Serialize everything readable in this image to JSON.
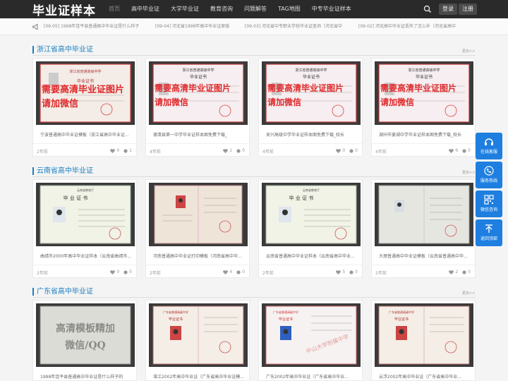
{
  "header": {
    "logo": "毕业证样本",
    "nav": [
      "首页",
      "高中毕业证",
      "大学毕业证",
      "教育咨询",
      "问题解答",
      "TAG地图",
      "中专毕业证样本"
    ],
    "login": "登录",
    "register": "注册"
  },
  "ticker": [
    "[09-05] 1998年连平县普通高中毕业证是什么样子",
    "[09-04] 河北省1998年高中毕业证原版",
    "[09-03] 河北省中专职业学校毕业证查询（河北省中",
    "[09-02] 河北高中毕业证丢失了怎么补（河北省高中"
  ],
  "more_label": "更多>>",
  "sections": [
    {
      "title": "浙江省高中毕业证",
      "cards": [
        {
          "caption": "宁波普通高中毕业证模板（浙江省高中毕业证...",
          "age": "2年前",
          "likes": "0",
          "comments": "1"
        },
        {
          "caption": "德清县第一中学毕业证样本图免费下载_",
          "age": "4年前",
          "likes": "1",
          "comments": "0"
        },
        {
          "caption": "吴兴高级中学毕业证样本图免费下载_校长",
          "age": "4年前",
          "likes": "0",
          "comments": "0"
        },
        {
          "caption": "湖州市菱湖中学毕业证样本图免费下载_校长",
          "age": "4年前",
          "likes": "6",
          "comments": "0"
        }
      ]
    },
    {
      "title": "云南省高中毕业证",
      "cards": [
        {
          "caption": "曲靖市2000年高中毕业证样本（云南省曲靖市...",
          "age": "2年前",
          "likes": "0",
          "comments": "0"
        },
        {
          "caption": "河南普通高中毕业证打印模板（河南省高中毕...",
          "age": "2年前",
          "likes": "4",
          "comments": "0"
        },
        {
          "caption": "云南省普通高中毕业证样本（云南省高中毕业...",
          "age": "2年前",
          "likes": "5",
          "comments": "0"
        },
        {
          "caption": "大理普通高中毕业证模板（云南省普通高中毕...",
          "age": "2年前",
          "likes": "2",
          "comments": "0"
        }
      ]
    },
    {
      "title": "广东省高中毕业证",
      "cards": [
        {
          "caption": "1998年连平县普通高中毕业证是什么样子的",
          "age": "",
          "likes": "",
          "comments": ""
        },
        {
          "caption": "湛江2002年高中毕业证（广东省高中毕业证模...",
          "age": "",
          "likes": "",
          "comments": ""
        },
        {
          "caption": "广东2002年高中毕业证（广东省高中毕业...",
          "age": "",
          "likes": "",
          "comments": ""
        },
        {
          "caption": "云浮2002年高中毕业证（广东省高中毕业...",
          "age": "",
          "likes": "",
          "comments": ""
        }
      ]
    }
  ],
  "watermarks": {
    "line1": "需要高清毕业证图片",
    "line2": "请加微信",
    "gd1": "高清模板精加",
    "gd2": "微信/QQ"
  },
  "cert_text": {
    "zj_school": "浙江省普通高级中学",
    "zj_school_alt": "浙江省普通高级中学",
    "cert": "毕业证书",
    "yn_title": "毕 业 证 书",
    "yn_dept": "云南省教育厅",
    "gd_school": "广东省普通高级中学",
    "gd_cert": "毕业证书",
    "gd_stamp": "中山大学附属中学"
  },
  "float_panel": [
    "在线客服",
    "服务热线",
    "微信咨询",
    "返回顶部"
  ],
  "colors": {
    "accent": "#1a7fc1",
    "float": "#1e7fe0",
    "header": "#2a2a2a"
  }
}
